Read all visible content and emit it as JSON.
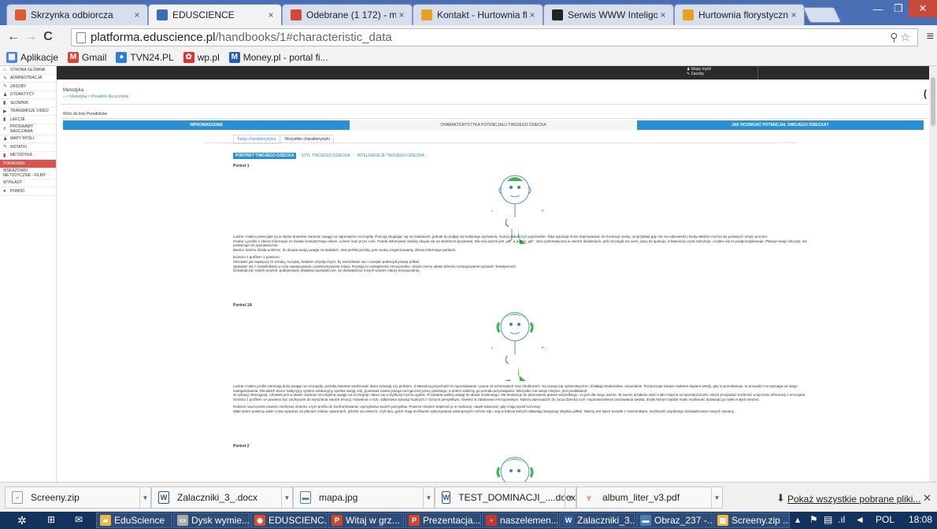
{
  "browser": {
    "tabs": [
      {
        "title": "Skrzynka odbiorcza",
        "icon": "mail-icon",
        "color": "#e05a2b",
        "active": false
      },
      {
        "title": "EDUSCIENCE",
        "icon": "eduscience-icon",
        "color": "#3a6fb5",
        "active": true
      },
      {
        "title": "Odebrane (1 172) - marta.",
        "icon": "gmail-icon",
        "color": "#d44638",
        "active": false
      },
      {
        "title": "Kontakt - Hurtownia flory",
        "icon": "e-icon",
        "color": "#e8a020",
        "active": false
      },
      {
        "title": "Serwis WWW Inteligo",
        "icon": "inteligo-icon",
        "color": "#222222",
        "active": false
      },
      {
        "title": "Hurtownia florystyczna, H",
        "icon": "e-icon",
        "color": "#e8a020",
        "active": false
      }
    ],
    "url_domain": "platforma.eduscience.pl",
    "url_path": "/handbooks/1#characteristic_data",
    "bookmarks": [
      {
        "label": "Aplikacje",
        "icon": "apps-icon",
        "color": "#4a86e8"
      },
      {
        "label": "Gmail",
        "icon": "gmail-icon",
        "color": "#d44638"
      },
      {
        "label": "TVN24.PL",
        "icon": "tvn-icon",
        "color": "#2a7fd4"
      },
      {
        "label": "wp.pl",
        "icon": "wp-icon",
        "color": "#e0312a"
      },
      {
        "label": "Money.pl - portal fi...",
        "icon": "money-icon",
        "color": "#1f5fb4"
      }
    ]
  },
  "site": {
    "topbar_links": [
      "Mapy myśli",
      "Zasoby"
    ],
    "sidebar": [
      {
        "label": "Strona główna",
        "icon": "home-icon",
        "glyph": "⌂"
      },
      {
        "label": "Administracja",
        "icon": "wrench-icon",
        "glyph": "✎"
      },
      {
        "label": "Zasoby",
        "icon": "resources-icon",
        "glyph": "✎"
      },
      {
        "label": "Dydaktycy",
        "icon": "user-icon",
        "glyph": "♟"
      },
      {
        "label": "Słownik",
        "icon": "book-icon",
        "glyph": "▮"
      },
      {
        "label": "Transmisje video",
        "icon": "video-icon",
        "glyph": "▶"
      },
      {
        "label": "Lekcje",
        "icon": "lesson-icon",
        "glyph": "▮"
      },
      {
        "label": "Programy nauczania",
        "icon": "program-icon",
        "glyph": "≡"
      },
      {
        "label": "Mapy myśli",
        "icon": "mindmap-icon",
        "glyph": "♟"
      },
      {
        "label": "Notatki",
        "icon": "note-icon",
        "glyph": "✎"
      },
      {
        "label": "Metodyka",
        "icon": "method-icon",
        "glyph": "▮"
      },
      {
        "label": "Poradniki",
        "icon": "",
        "glyph": ""
      },
      {
        "label": "Wskazówki metodyczne - filmy",
        "icon": "",
        "glyph": ""
      },
      {
        "label": "Wykłady",
        "icon": "",
        "glyph": ""
      },
      {
        "label": "Pomoc",
        "icon": "help-icon",
        "glyph": "●"
      }
    ],
    "page_title": "Metodyka",
    "breadcrumb": "⌂ > Metodyka > Poradnik dla uczniów",
    "back_link": "Wróć do listy Poradników",
    "main_tabs": [
      "Wprowadzenie",
      "Charakterystyka potencjału Twojego dziecka",
      "Jak rozwijać potencjał Swojego dziecka?"
    ],
    "sub_tabs": [
      "Twoja charakterystyka",
      "Wszystkie charakterystyki"
    ],
    "pills": [
      "Portret Twojego dziecka",
      "Styl Twojego dziecka",
      "Inteligencje Twojego dziecka"
    ],
    "portret1": {
      "heading": "Portret 1",
      "paragraphs": [
        "Ludzie o takim potencjale są w stanie dowolnie zwracać uwagę na najmniejsze szczegóły. Pracują skupiając się na zadaniach, jednak by podjąć się kolejnego wyzwania, muszą zakończyć poprzednie. Taka sytuacja może doprowadzać do frustracji osoby, na przykład gdy nie ma odpowiedzi, kiedy właśnie można się poświęcić innym procom.",
        "Osoba o profilu 1 zbiera informacje ze świata zewnętrznego okiem, uchem oraz przez ruch. Potrafi dokonywać analizy skupia się na strukturze językowej. Dla niej ważne jest „co”, a potem „jak”. Jest systematyczna w swoich działaniach, jeśli szczegół ma sens, dąży do spokoju. Z łatwością czyta instrukcje i szybko się im podporządkowuje. Planuje swoje decyzje, nie podejmuje ich spontanicznie.",
        "Bardzo dobrze działa w sferze, do skupia swoją uwagę na detalach. Jest perfekcjonistą, jest osobą zorganizowaną, zbiera informacje partiami.",
        "Dziecko z profilem 1 powinno:",
        "Obcować jak najwięcej ze sztuką, muzyką, światem artystycznym, by uwrażliwiać się i rozwijać potencjał prawej półkuli.",
        "Spotykać się z rówieśnikami w celu nawiązywania i podtrzymywania relacji. Rozwija to umiejętności emocjonalne, dzięki czemu ułatwi dziecku rozwiązywanie wyzwań i kreatywność.",
        "Doświadczać miłych wrażeń, podejmować działania spontaniczne, by doświadczyć innych wrażeń natury emocjonalnej."
      ]
    },
    "portret1a": {
      "heading": "Portret 1A",
      "paragraphs": [
        "Ludzie o takim profilu zwracają dużą uwagę na szczegóły, potrafią świetnie analizować daną sytuację czy problem. Z łatwością przychodzi im wyszukiwanie i praca na schematach oraz strukturach. Są zazwyczaj systematyczne i działają strukturalnie, racjonalnie. Rozpoznaje kolejne zadanie dopiero wtedy, gdy to przeskanuje, to prowadzi mu wymaga od niego zaangażowania. Dla takich dzieci tradycyjny system edukacyjny spełnia swoją rolę, ponieważ nauka polega na logicznej pracy polskiego, a potem widzimy go pomału przyswajania. Wszystko ma swoje miejsce, jest poukładane.",
        "W sytuacji stresującej, człowiek jest w stanie zwracać szczególną uwagę na szczegóły i łatwo się w dyskusji można zgubić. Przykłada wielką uwagę do słowa mówionego. Ma tendencje do planowania prawie wszystkiego, co jest dla niego ważne. W swoim działaniu widzi mało miejsca na spontaniczność. Może przejawiać trudności w łączeniu informacji z emocjami.",
        "Dziecko z profilem 1A powinno być zachęcane do wyrażania swoich emocji, mówienia o nich, odbierania sytuacji trudnych z różnych perspektyw, również w zabawowo emocjonalnym. Należy wprowadzić do życia dziecka ruch i wydoskonalenie poznawania świata, dzięki którym będzie miało możliwość doświadczyć wielu miłych wrażeń.",
        "Rodzice nauczyciele powinni zachęcać dziecko o tym profilu do konfrontowania i wymyślania swoich pomysłów. Powinni również wspierać je w realizacji, nawet wówczas, gdy znają wynik końcowy.",
        "Małe dzieci powinny wiele czasu spędzać na placach zabaw, spacerach, jeździe na rowerze, czyli tam, gdzie mają możliwość wykonywania nastrojowych ruchów rąk i nóg w trakcie których ułatwiają integrację obydwu półkul. Ważny jest także kontakt z rówieśnikami, możliwość wspólnego doświadczania nowych sytuacji."
      ]
    },
    "portret2": {
      "heading": "Portret 2"
    },
    "figure_letters": {
      "left": "L",
      "right": "P"
    }
  },
  "downloads": {
    "items": [
      {
        "name": "Screeny.zip",
        "icon": "zip-icon",
        "color": "#7a7a7a"
      },
      {
        "name": "Zalaczniki_3_.docx",
        "icon": "docx-icon",
        "color": "#2b5797"
      },
      {
        "name": "mapa.jpg",
        "icon": "image-icon",
        "color": "#4a7fb0"
      },
      {
        "name": "TEST_DOMINACJI_....docx",
        "icon": "docx-icon",
        "color": "#2b5797"
      },
      {
        "name": "album_liter_v3.pdf",
        "icon": "pdf-icon",
        "color": "#c0392b"
      }
    ],
    "show_all": "Pokaż wszystkie pobrane pliki..."
  },
  "taskbar": {
    "items": [
      {
        "label": "EduScience",
        "icon": "folder-icon",
        "color": "#e8b84a"
      },
      {
        "label": "Dysk wymie...",
        "icon": "drive-icon",
        "color": "#aaaaaa"
      },
      {
        "label": "EDUSCIENC...",
        "icon": "chrome-icon",
        "color": "#e04a2b"
      },
      {
        "label": "Witaj w grz...",
        "icon": "ppt-icon",
        "color": "#d2472b"
      },
      {
        "label": "Prezentacja...",
        "icon": "ppt-icon",
        "color": "#d2472b"
      },
      {
        "label": "naszelemen...",
        "icon": "pdf-icon",
        "color": "#c0392b"
      },
      {
        "label": "Zalaczniki_3...",
        "icon": "word-icon",
        "color": "#2b5797"
      },
      {
        "label": "Obraz_237 -...",
        "icon": "image-icon",
        "color": "#4a7fb0"
      },
      {
        "label": "Screeny.zip ...",
        "icon": "zip-icon",
        "color": "#e8b84a"
      }
    ],
    "language": "POL",
    "time": "18:08"
  }
}
